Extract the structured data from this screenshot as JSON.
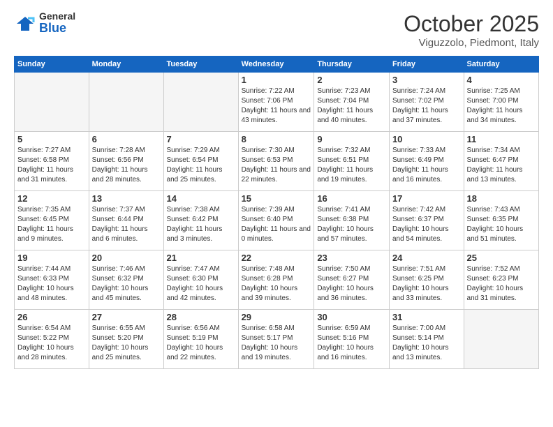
{
  "logo": {
    "general": "General",
    "blue": "Blue"
  },
  "title": "October 2025",
  "subtitle": "Viguzzolo, Piedmont, Italy",
  "days_of_week": [
    "Sunday",
    "Monday",
    "Tuesday",
    "Wednesday",
    "Thursday",
    "Friday",
    "Saturday"
  ],
  "weeks": [
    [
      {
        "day": "",
        "info": ""
      },
      {
        "day": "",
        "info": ""
      },
      {
        "day": "",
        "info": ""
      },
      {
        "day": "1",
        "info": "Sunrise: 7:22 AM\nSunset: 7:06 PM\nDaylight: 11 hours and 43 minutes."
      },
      {
        "day": "2",
        "info": "Sunrise: 7:23 AM\nSunset: 7:04 PM\nDaylight: 11 hours and 40 minutes."
      },
      {
        "day": "3",
        "info": "Sunrise: 7:24 AM\nSunset: 7:02 PM\nDaylight: 11 hours and 37 minutes."
      },
      {
        "day": "4",
        "info": "Sunrise: 7:25 AM\nSunset: 7:00 PM\nDaylight: 11 hours and 34 minutes."
      }
    ],
    [
      {
        "day": "5",
        "info": "Sunrise: 7:27 AM\nSunset: 6:58 PM\nDaylight: 11 hours and 31 minutes."
      },
      {
        "day": "6",
        "info": "Sunrise: 7:28 AM\nSunset: 6:56 PM\nDaylight: 11 hours and 28 minutes."
      },
      {
        "day": "7",
        "info": "Sunrise: 7:29 AM\nSunset: 6:54 PM\nDaylight: 11 hours and 25 minutes."
      },
      {
        "day": "8",
        "info": "Sunrise: 7:30 AM\nSunset: 6:53 PM\nDaylight: 11 hours and 22 minutes."
      },
      {
        "day": "9",
        "info": "Sunrise: 7:32 AM\nSunset: 6:51 PM\nDaylight: 11 hours and 19 minutes."
      },
      {
        "day": "10",
        "info": "Sunrise: 7:33 AM\nSunset: 6:49 PM\nDaylight: 11 hours and 16 minutes."
      },
      {
        "day": "11",
        "info": "Sunrise: 7:34 AM\nSunset: 6:47 PM\nDaylight: 11 hours and 13 minutes."
      }
    ],
    [
      {
        "day": "12",
        "info": "Sunrise: 7:35 AM\nSunset: 6:45 PM\nDaylight: 11 hours and 9 minutes."
      },
      {
        "day": "13",
        "info": "Sunrise: 7:37 AM\nSunset: 6:44 PM\nDaylight: 11 hours and 6 minutes."
      },
      {
        "day": "14",
        "info": "Sunrise: 7:38 AM\nSunset: 6:42 PM\nDaylight: 11 hours and 3 minutes."
      },
      {
        "day": "15",
        "info": "Sunrise: 7:39 AM\nSunset: 6:40 PM\nDaylight: 11 hours and 0 minutes."
      },
      {
        "day": "16",
        "info": "Sunrise: 7:41 AM\nSunset: 6:38 PM\nDaylight: 10 hours and 57 minutes."
      },
      {
        "day": "17",
        "info": "Sunrise: 7:42 AM\nSunset: 6:37 PM\nDaylight: 10 hours and 54 minutes."
      },
      {
        "day": "18",
        "info": "Sunrise: 7:43 AM\nSunset: 6:35 PM\nDaylight: 10 hours and 51 minutes."
      }
    ],
    [
      {
        "day": "19",
        "info": "Sunrise: 7:44 AM\nSunset: 6:33 PM\nDaylight: 10 hours and 48 minutes."
      },
      {
        "day": "20",
        "info": "Sunrise: 7:46 AM\nSunset: 6:32 PM\nDaylight: 10 hours and 45 minutes."
      },
      {
        "day": "21",
        "info": "Sunrise: 7:47 AM\nSunset: 6:30 PM\nDaylight: 10 hours and 42 minutes."
      },
      {
        "day": "22",
        "info": "Sunrise: 7:48 AM\nSunset: 6:28 PM\nDaylight: 10 hours and 39 minutes."
      },
      {
        "day": "23",
        "info": "Sunrise: 7:50 AM\nSunset: 6:27 PM\nDaylight: 10 hours and 36 minutes."
      },
      {
        "day": "24",
        "info": "Sunrise: 7:51 AM\nSunset: 6:25 PM\nDaylight: 10 hours and 33 minutes."
      },
      {
        "day": "25",
        "info": "Sunrise: 7:52 AM\nSunset: 6:23 PM\nDaylight: 10 hours and 31 minutes."
      }
    ],
    [
      {
        "day": "26",
        "info": "Sunrise: 6:54 AM\nSunset: 5:22 PM\nDaylight: 10 hours and 28 minutes."
      },
      {
        "day": "27",
        "info": "Sunrise: 6:55 AM\nSunset: 5:20 PM\nDaylight: 10 hours and 25 minutes."
      },
      {
        "day": "28",
        "info": "Sunrise: 6:56 AM\nSunset: 5:19 PM\nDaylight: 10 hours and 22 minutes."
      },
      {
        "day": "29",
        "info": "Sunrise: 6:58 AM\nSunset: 5:17 PM\nDaylight: 10 hours and 19 minutes."
      },
      {
        "day": "30",
        "info": "Sunrise: 6:59 AM\nSunset: 5:16 PM\nDaylight: 10 hours and 16 minutes."
      },
      {
        "day": "31",
        "info": "Sunrise: 7:00 AM\nSunset: 5:14 PM\nDaylight: 10 hours and 13 minutes."
      },
      {
        "day": "",
        "info": ""
      }
    ]
  ]
}
